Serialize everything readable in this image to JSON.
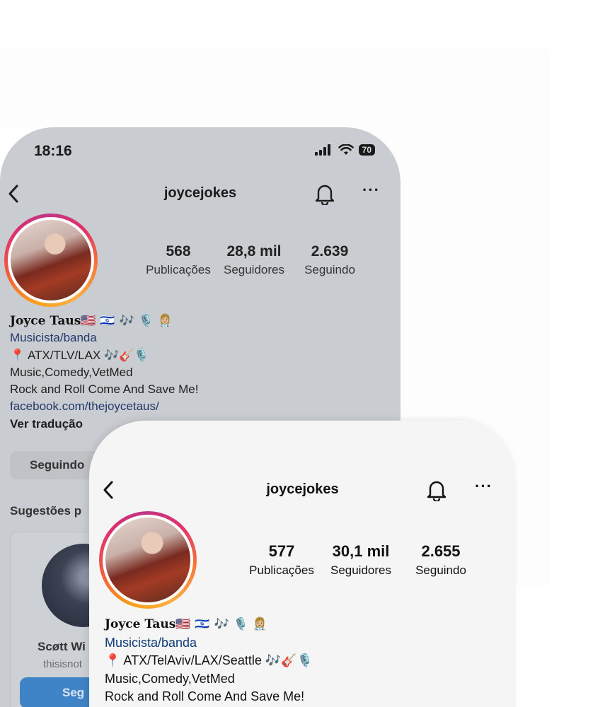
{
  "back_phone": {
    "status": {
      "time": "18:16",
      "battery": "70"
    },
    "username": "joycejokes",
    "stats": [
      {
        "value": "568",
        "label": "Publicações"
      },
      {
        "value": "28,8 mil",
        "label": "Seguidores"
      },
      {
        "value": "2.639",
        "label": "Seguindo"
      }
    ],
    "bio": {
      "name": "Joyce Taus🇺🇸 🇮🇱 🎶 🎙️ 👩🏼‍⚕️",
      "category": "Musicista/banda",
      "location": "📍 ATX/TLV/LAX 🎶🎸🎙️",
      "line1": "Music,Comedy,VetMed",
      "line2": "Rock and Roll Come And Save Me!",
      "link": "facebook.com/thejoycetaus/",
      "translate": "Ver tradução"
    },
    "follow_button": "Seguindo",
    "suggestions_title": "Sugestões p",
    "suggestion": {
      "name": "Scøtt Wi",
      "handle": "thisisnot",
      "button": "Seg"
    }
  },
  "front_phone": {
    "username": "joycejokes",
    "stats": [
      {
        "value": "577",
        "label": "Publicações"
      },
      {
        "value": "30,1 mil",
        "label": "Seguidores"
      },
      {
        "value": "2.655",
        "label": "Seguindo"
      }
    ],
    "bio": {
      "name": "Joyce Taus🇺🇸 🇮🇱 🎶 🎙️ 👩🏼‍⚕️",
      "category": "Musicista/banda",
      "location": "📍 ATX/TelAviv/LAX/Seattle 🎶🎸🎙️",
      "line1": "Music,Comedy,VetMed",
      "line2": "Rock and Roll Come And Save Me!"
    }
  }
}
